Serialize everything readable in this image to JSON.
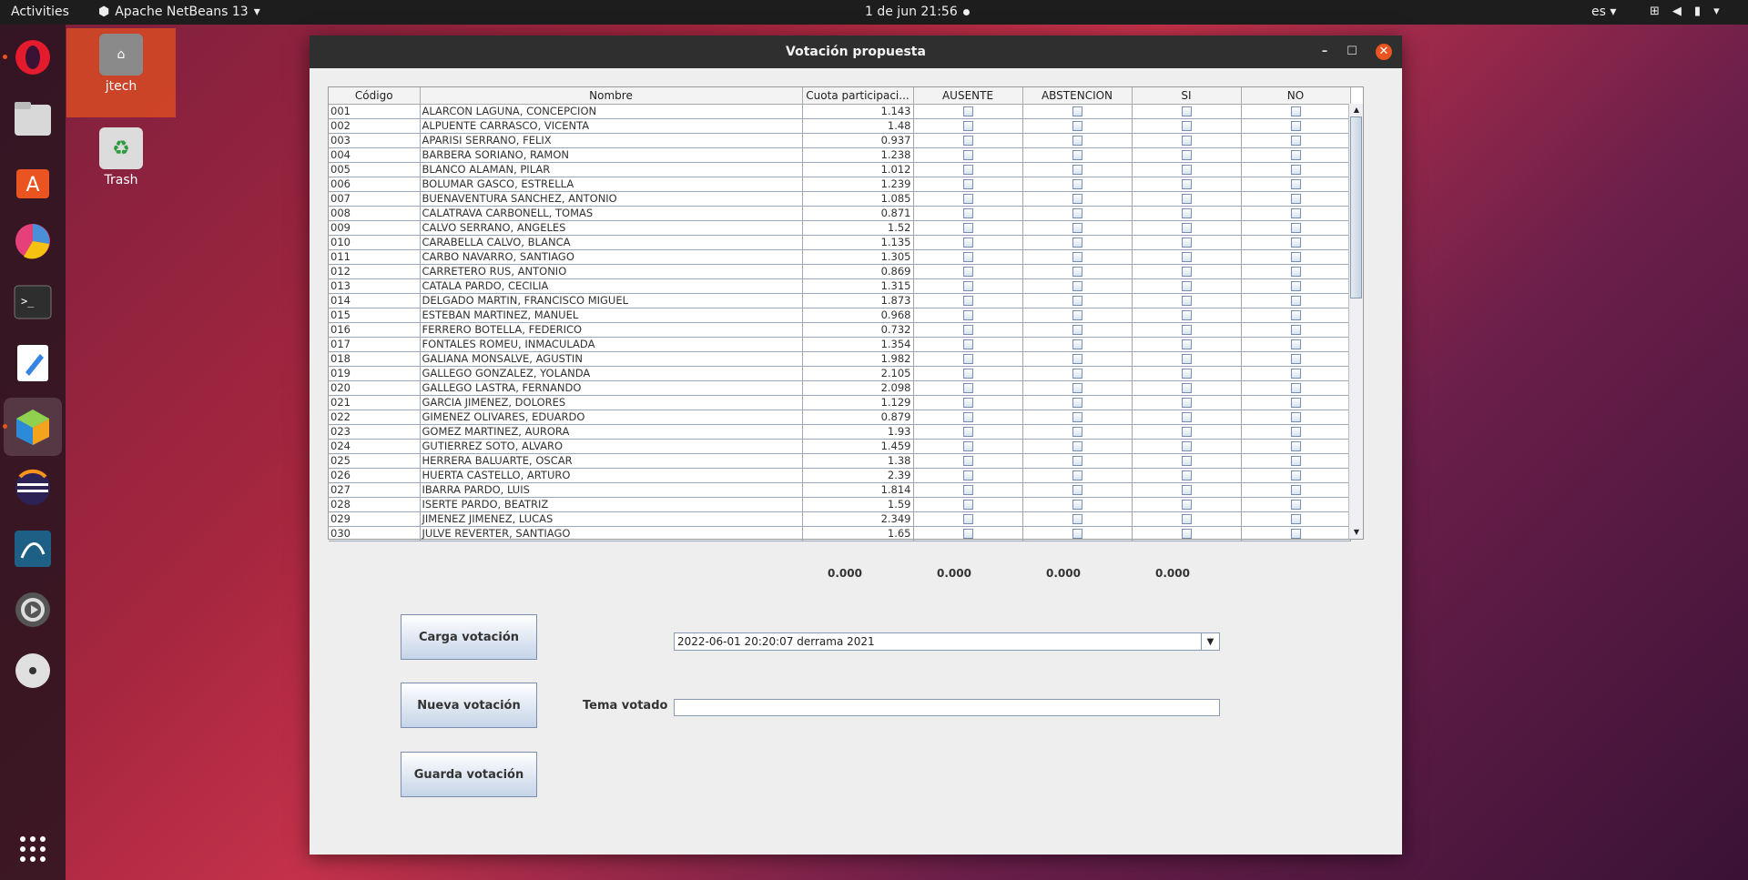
{
  "topbar": {
    "activities": "Activities",
    "app_name": "Apache NetBeans 13",
    "clock": "1 de jun  21:56",
    "lang": "es"
  },
  "desktop": {
    "home_label": "jtech",
    "trash_label": "Trash"
  },
  "window": {
    "title": "Votación propuesta",
    "columns": [
      "Código",
      "Nombre",
      "Cuota participaci...",
      "AUSENTE",
      "ABSTENCION",
      "SI",
      "NO"
    ],
    "rows": [
      {
        "code": "001",
        "name": "ALARCON LAGUNA, CONCEPCION",
        "cuota": "1.143"
      },
      {
        "code": "002",
        "name": "ALPUENTE CARRASCO, VICENTA",
        "cuota": "1.48"
      },
      {
        "code": "003",
        "name": "APARISI  SERRANO, FELIX",
        "cuota": "0.937"
      },
      {
        "code": "004",
        "name": "BARBERA SORIANO, RAMON",
        "cuota": "1.238"
      },
      {
        "code": "005",
        "name": "BLANCO ALAMAN, PILAR",
        "cuota": "1.012"
      },
      {
        "code": "006",
        "name": "BOLUMAR GASCO, ESTRELLA",
        "cuota": "1.239"
      },
      {
        "code": "007",
        "name": "BUENAVENTURA SANCHEZ, ANTONIO",
        "cuota": "1.085"
      },
      {
        "code": "008",
        "name": "CALATRAVA CARBONELL, TOMAS",
        "cuota": "0.871"
      },
      {
        "code": "009",
        "name": "CALVO SERRANO, ANGELES",
        "cuota": "1.52"
      },
      {
        "code": "010",
        "name": "CARABELLA CALVO, BLANCA",
        "cuota": "1.135"
      },
      {
        "code": "011",
        "name": "CARBO NAVARRO, SANTIAGO",
        "cuota": "1.305"
      },
      {
        "code": "012",
        "name": "CARRETERO RUS, ANTONIO",
        "cuota": "0.869"
      },
      {
        "code": "013",
        "name": "CATALA PARDO, CECILIA",
        "cuota": "1.315"
      },
      {
        "code": "014",
        "name": "DELGADO MARTIN, FRANCISCO MIGUEL",
        "cuota": "1.873"
      },
      {
        "code": "015",
        "name": "ESTEBAN MARTINEZ, MANUEL",
        "cuota": "0.968"
      },
      {
        "code": "016",
        "name": "FERRERO BOTELLA, FEDERICO",
        "cuota": "0.732"
      },
      {
        "code": "017",
        "name": "FONTALES ROMEU, INMACULADA",
        "cuota": "1.354"
      },
      {
        "code": "018",
        "name": "GALIANA MONSALVE, AGUSTIN",
        "cuota": "1.982"
      },
      {
        "code": "019",
        "name": "GALLEGO GONZALEZ, YOLANDA",
        "cuota": "2.105"
      },
      {
        "code": "020",
        "name": "GALLEGO LASTRA, FERNANDO",
        "cuota": "2.098"
      },
      {
        "code": "021",
        "name": "GARCIA JIMENEZ, DOLORES",
        "cuota": "1.129"
      },
      {
        "code": "022",
        "name": "GIMENEZ OLIVARES, EDUARDO",
        "cuota": "0.879"
      },
      {
        "code": "023",
        "name": "GOMEZ MARTINEZ, AURORA",
        "cuota": "1.93"
      },
      {
        "code": "024",
        "name": "GUTIERREZ SOTO, ALVARO",
        "cuota": "1.459"
      },
      {
        "code": "025",
        "name": "HERRERA BALUARTE, OSCAR",
        "cuota": "1.38"
      },
      {
        "code": "026",
        "name": "HUERTA CASTELLO, ARTURO",
        "cuota": "2.39"
      },
      {
        "code": "027",
        "name": "IBARRA PARDO, LUIS",
        "cuota": "1.814"
      },
      {
        "code": "028",
        "name": "ISERTE PARDO, BEATRIZ",
        "cuota": "1.59"
      },
      {
        "code": "029",
        "name": "JIMENEZ JIMENEZ, LUCAS",
        "cuota": "2.349"
      },
      {
        "code": "030",
        "name": "JULVE REVERTER, SANTIAGO",
        "cuota": "1.65"
      }
    ],
    "totals": {
      "ausente": "0.000",
      "abstencion": "0.000",
      "si": "0.000",
      "no": "0.000"
    },
    "buttons": {
      "carga": "Carga votación",
      "nueva": "Nueva votación",
      "guarda": "Guarda votación"
    },
    "combo_value": "2022-06-01 20:20:07     derrama 2021",
    "tema_label": "Tema votado",
    "tema_value": ""
  }
}
